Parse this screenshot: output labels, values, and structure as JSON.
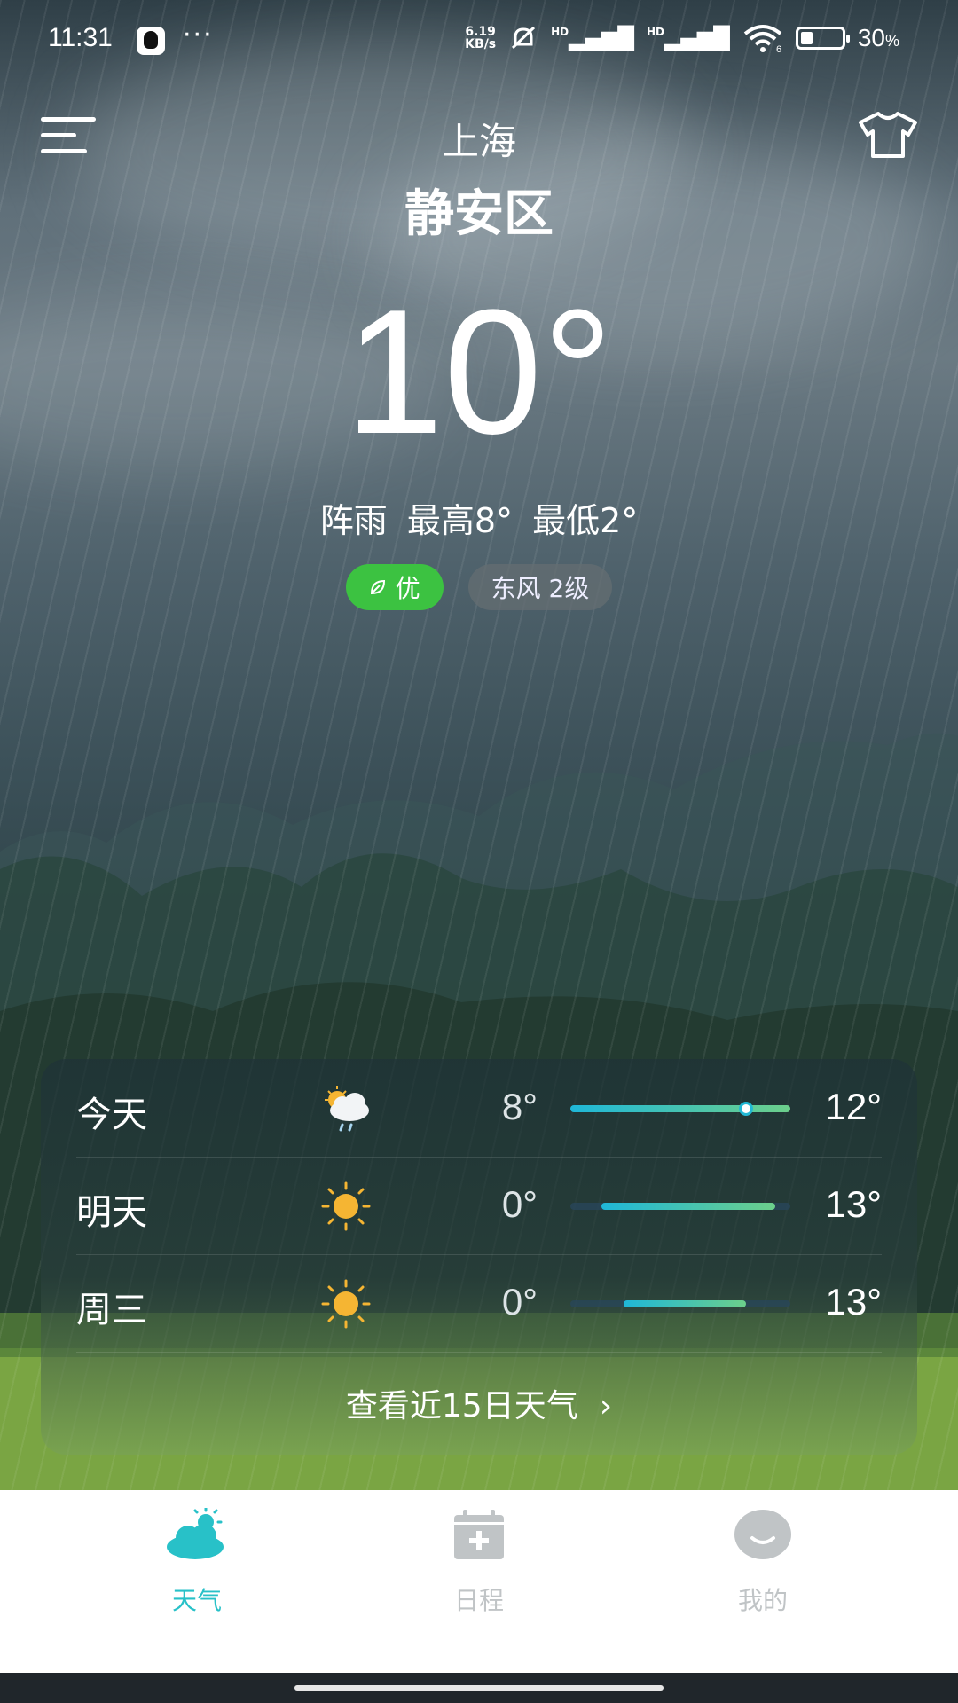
{
  "status_bar": {
    "time": "11:31",
    "more": "···",
    "net_speed_top": "6.19",
    "net_speed_bottom": "KB/s",
    "signal1": "HD",
    "signal2": "HD",
    "wifi_level": "6",
    "battery_pct": "30",
    "battery_unit": "%",
    "battery_level": 0.3
  },
  "header": {
    "city": "上海",
    "district": "静安区"
  },
  "current": {
    "temp": "10°",
    "summary": "阵雨  最高8°  最低2°",
    "aqi": "优",
    "wind": "东风  2级"
  },
  "forecast": [
    {
      "day": "今天",
      "icon": "cloud-rain-sun-icon",
      "lo": "8°",
      "hi": "12°",
      "bar_start": 0.0,
      "bar_end": 1.0,
      "current_pos": 0.8
    },
    {
      "day": "明天",
      "icon": "sun-icon",
      "lo": "0°",
      "hi": "13°",
      "bar_start": 0.14,
      "bar_end": 0.93
    },
    {
      "day": "周三",
      "icon": "sun-icon",
      "lo": "0°",
      "hi": "13°",
      "bar_start": 0.24,
      "bar_end": 0.8
    }
  ],
  "more_link": "查看近15日天气",
  "tabs": [
    {
      "label": "天气",
      "icon": "weather-cloud-icon",
      "active": true
    },
    {
      "label": "日程",
      "icon": "calendar-add-icon",
      "active": false
    },
    {
      "label": "我的",
      "icon": "profile-face-icon",
      "active": false
    }
  ],
  "colors": {
    "accent": "#28c1c8",
    "aqi_good": "#3cc241",
    "tab_inactive": "#c0c4c6"
  }
}
